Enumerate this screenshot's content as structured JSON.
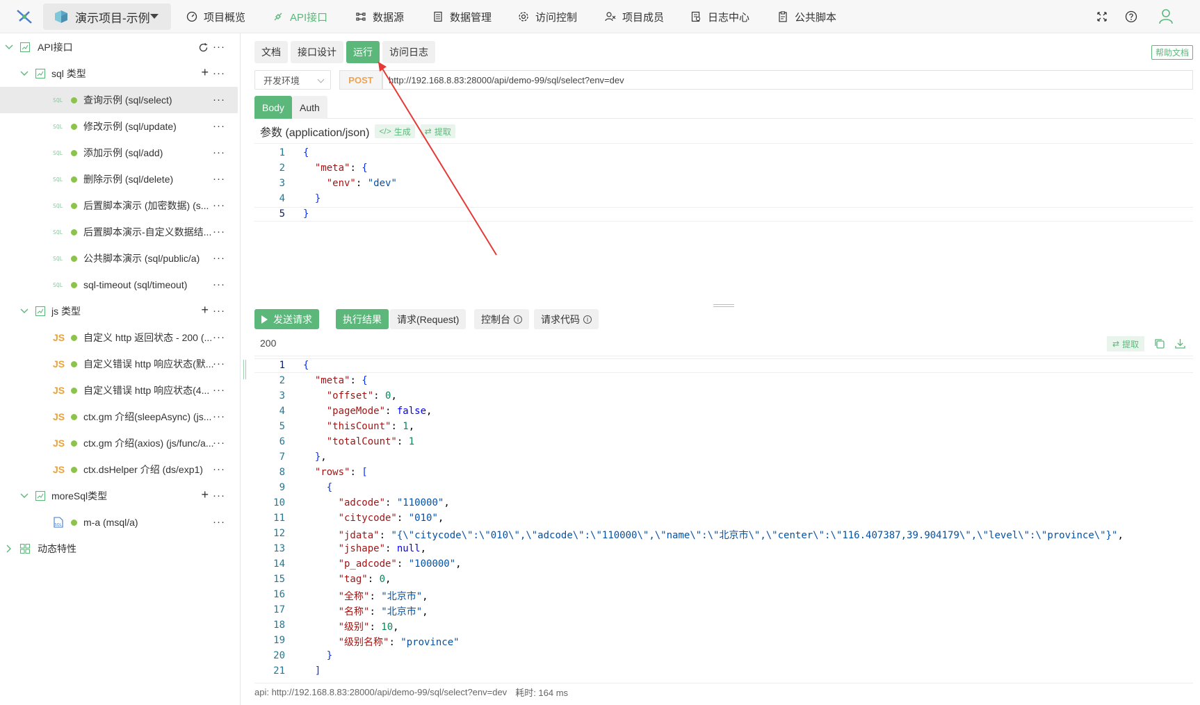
{
  "header": {
    "project_name": "演示项目-示例",
    "nav": [
      {
        "label": "项目概览",
        "icon": "dashboard-icon"
      },
      {
        "label": "API接口",
        "icon": "api-icon"
      },
      {
        "label": "数据源",
        "icon": "datasource-icon"
      },
      {
        "label": "数据管理",
        "icon": "data-management-icon"
      },
      {
        "label": "访问控制",
        "icon": "gear-icon"
      },
      {
        "label": "项目成员",
        "icon": "members-icon"
      },
      {
        "label": "日志中心",
        "icon": "log-icon"
      },
      {
        "label": "公共脚本",
        "icon": "script-icon"
      }
    ],
    "active_nav": "API接口"
  },
  "sidebar": {
    "root": {
      "label": "API接口"
    },
    "groups": [
      {
        "label": "sql 类型",
        "items": [
          {
            "label": "查询示例 (sql/select)",
            "type": "SQL",
            "selected": true
          },
          {
            "label": "修改示例 (sql/update)",
            "type": "SQL"
          },
          {
            "label": "添加示例 (sql/add)",
            "type": "SQL"
          },
          {
            "label": "删除示例 (sql/delete)",
            "type": "SQL"
          },
          {
            "label": "后置脚本演示 (加密数据) (s...",
            "type": "SQL"
          },
          {
            "label": "后置脚本演示-自定义数据结...",
            "type": "SQL"
          },
          {
            "label": "公共脚本演示 (sql/public/a)",
            "type": "SQL"
          },
          {
            "label": "sql-timeout (sql/timeout)",
            "type": "SQL"
          }
        ]
      },
      {
        "label": "js 类型",
        "items": [
          {
            "label": "自定义 http 返回状态 - 200 (...",
            "type": "JS"
          },
          {
            "label": "自定义错误 http 响应状态(默...",
            "type": "JS"
          },
          {
            "label": "自定义错误 http 响应状态(4...",
            "type": "JS"
          },
          {
            "label": "ctx.gm 介绍(sleepAsync) (js...",
            "type": "JS"
          },
          {
            "label": "ctx.gm 介绍(axios) (js/func/a...",
            "type": "JS"
          },
          {
            "label": "ctx.dsHelper 介绍 (ds/exp1)",
            "type": "JS"
          }
        ]
      },
      {
        "label": "moreSql类型",
        "items": [
          {
            "label": "m-a (msql/a)",
            "type": "MSQL"
          }
        ]
      }
    ],
    "dynamic": {
      "label": "动态特性"
    },
    "sql_tag": "SQL",
    "js_tag": "JS"
  },
  "tabs": [
    "文档",
    "接口设计",
    "运行",
    "访问日志"
  ],
  "active_tab": "运行",
  "help_label": "帮助文档",
  "request": {
    "env": "开发环境",
    "method": "POST",
    "url": "http://192.168.8.83:28000/api/demo-99/sql/select?env=dev"
  },
  "subtabs": [
    "Body",
    "Auth"
  ],
  "param_label": "参数 (application/json)",
  "param_buttons": {
    "generate": "生成",
    "extract": "提取"
  },
  "request_body_lines": [
    "{",
    "  \"meta\": {",
    "    \"env\": \"dev\"",
    "  }",
    "}"
  ],
  "actions": {
    "send": "发送请求",
    "result": "执行结果",
    "request": "请求(Request)",
    "console": "控制台",
    "code": "请求代码"
  },
  "response": {
    "status": "200",
    "extract": "提取",
    "lines": [
      "{",
      "  \"meta\": {",
      "    \"offset\": 0,",
      "    \"pageMode\": false,",
      "    \"thisCount\": 1,",
      "    \"totalCount\": 1",
      "  },",
      "  \"rows\": [",
      "    {",
      "      \"adcode\": \"110000\",",
      "      \"citycode\": \"010\",",
      "      \"jdata\": \"{\\\"citycode\\\":\\\"010\\\",\\\"adcode\\\":\\\"110000\\\",\\\"name\\\":\\\"北京市\\\",\\\"center\\\":\\\"116.407387,39.904179\\\",\\\"level\\\":\\\"province\\\"}\",",
      "      \"jshape\": null,",
      "      \"p_adcode\": \"100000\",",
      "      \"tag\": 0,",
      "      \"全称\": \"北京市\",",
      "      \"名称\": \"北京市\",",
      "      \"级别\": 10,",
      "      \"级别名称\": \"province\"",
      "    }",
      "  ]"
    ]
  },
  "footer": {
    "api": "api: http://192.168.8.83:28000/api/demo-99/sql/select?env=dev",
    "time": "耗时: 164 ms"
  },
  "colors": {
    "accent": "#5bb87a",
    "post": "#f0a24e",
    "js": "#e9a23b"
  }
}
